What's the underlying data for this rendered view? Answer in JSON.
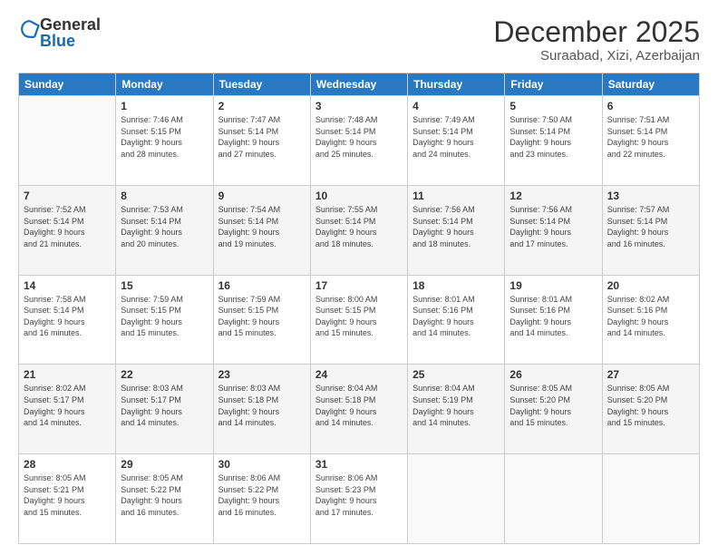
{
  "logo": {
    "general": "General",
    "blue": "Blue"
  },
  "header": {
    "month": "December 2025",
    "location": "Suraabad, Xizi, Azerbaijan"
  },
  "weekdays": [
    "Sunday",
    "Monday",
    "Tuesday",
    "Wednesday",
    "Thursday",
    "Friday",
    "Saturday"
  ],
  "days": [
    {
      "num": "",
      "info": ""
    },
    {
      "num": "1",
      "info": "Sunrise: 7:46 AM\nSunset: 5:15 PM\nDaylight: 9 hours\nand 28 minutes."
    },
    {
      "num": "2",
      "info": "Sunrise: 7:47 AM\nSunset: 5:14 PM\nDaylight: 9 hours\nand 27 minutes."
    },
    {
      "num": "3",
      "info": "Sunrise: 7:48 AM\nSunset: 5:14 PM\nDaylight: 9 hours\nand 25 minutes."
    },
    {
      "num": "4",
      "info": "Sunrise: 7:49 AM\nSunset: 5:14 PM\nDaylight: 9 hours\nand 24 minutes."
    },
    {
      "num": "5",
      "info": "Sunrise: 7:50 AM\nSunset: 5:14 PM\nDaylight: 9 hours\nand 23 minutes."
    },
    {
      "num": "6",
      "info": "Sunrise: 7:51 AM\nSunset: 5:14 PM\nDaylight: 9 hours\nand 22 minutes."
    },
    {
      "num": "7",
      "info": "Sunrise: 7:52 AM\nSunset: 5:14 PM\nDaylight: 9 hours\nand 21 minutes."
    },
    {
      "num": "8",
      "info": "Sunrise: 7:53 AM\nSunset: 5:14 PM\nDaylight: 9 hours\nand 20 minutes."
    },
    {
      "num": "9",
      "info": "Sunrise: 7:54 AM\nSunset: 5:14 PM\nDaylight: 9 hours\nand 19 minutes."
    },
    {
      "num": "10",
      "info": "Sunrise: 7:55 AM\nSunset: 5:14 PM\nDaylight: 9 hours\nand 18 minutes."
    },
    {
      "num": "11",
      "info": "Sunrise: 7:56 AM\nSunset: 5:14 PM\nDaylight: 9 hours\nand 18 minutes."
    },
    {
      "num": "12",
      "info": "Sunrise: 7:56 AM\nSunset: 5:14 PM\nDaylight: 9 hours\nand 17 minutes."
    },
    {
      "num": "13",
      "info": "Sunrise: 7:57 AM\nSunset: 5:14 PM\nDaylight: 9 hours\nand 16 minutes."
    },
    {
      "num": "14",
      "info": "Sunrise: 7:58 AM\nSunset: 5:14 PM\nDaylight: 9 hours\nand 16 minutes."
    },
    {
      "num": "15",
      "info": "Sunrise: 7:59 AM\nSunset: 5:15 PM\nDaylight: 9 hours\nand 15 minutes."
    },
    {
      "num": "16",
      "info": "Sunrise: 7:59 AM\nSunset: 5:15 PM\nDaylight: 9 hours\nand 15 minutes."
    },
    {
      "num": "17",
      "info": "Sunrise: 8:00 AM\nSunset: 5:15 PM\nDaylight: 9 hours\nand 15 minutes."
    },
    {
      "num": "18",
      "info": "Sunrise: 8:01 AM\nSunset: 5:16 PM\nDaylight: 9 hours\nand 14 minutes."
    },
    {
      "num": "19",
      "info": "Sunrise: 8:01 AM\nSunset: 5:16 PM\nDaylight: 9 hours\nand 14 minutes."
    },
    {
      "num": "20",
      "info": "Sunrise: 8:02 AM\nSunset: 5:16 PM\nDaylight: 9 hours\nand 14 minutes."
    },
    {
      "num": "21",
      "info": "Sunrise: 8:02 AM\nSunset: 5:17 PM\nDaylight: 9 hours\nand 14 minutes."
    },
    {
      "num": "22",
      "info": "Sunrise: 8:03 AM\nSunset: 5:17 PM\nDaylight: 9 hours\nand 14 minutes."
    },
    {
      "num": "23",
      "info": "Sunrise: 8:03 AM\nSunset: 5:18 PM\nDaylight: 9 hours\nand 14 minutes."
    },
    {
      "num": "24",
      "info": "Sunrise: 8:04 AM\nSunset: 5:18 PM\nDaylight: 9 hours\nand 14 minutes."
    },
    {
      "num": "25",
      "info": "Sunrise: 8:04 AM\nSunset: 5:19 PM\nDaylight: 9 hours\nand 14 minutes."
    },
    {
      "num": "26",
      "info": "Sunrise: 8:05 AM\nSunset: 5:20 PM\nDaylight: 9 hours\nand 15 minutes."
    },
    {
      "num": "27",
      "info": "Sunrise: 8:05 AM\nSunset: 5:20 PM\nDaylight: 9 hours\nand 15 minutes."
    },
    {
      "num": "28",
      "info": "Sunrise: 8:05 AM\nSunset: 5:21 PM\nDaylight: 9 hours\nand 15 minutes."
    },
    {
      "num": "29",
      "info": "Sunrise: 8:05 AM\nSunset: 5:22 PM\nDaylight: 9 hours\nand 16 minutes."
    },
    {
      "num": "30",
      "info": "Sunrise: 8:06 AM\nSunset: 5:22 PM\nDaylight: 9 hours\nand 16 minutes."
    },
    {
      "num": "31",
      "info": "Sunrise: 8:06 AM\nSunset: 5:23 PM\nDaylight: 9 hours\nand 17 minutes."
    }
  ]
}
